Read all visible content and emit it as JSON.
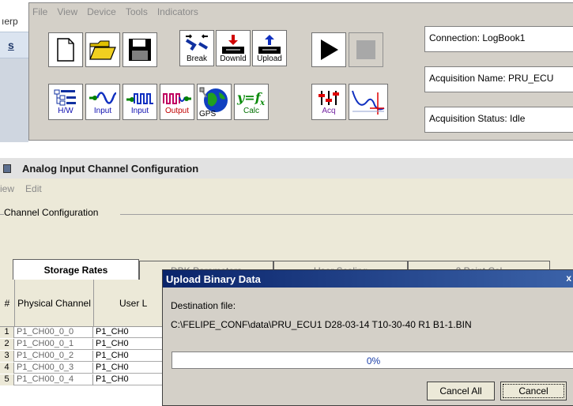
{
  "background_fragment": {
    "text1": "ıerp",
    "text2": "s"
  },
  "menubar": [
    "File",
    "View",
    "Device",
    "Tools",
    "Indicators"
  ],
  "toolbar": {
    "break": "Break",
    "download": "Downld",
    "upload": "Upload",
    "hw": "H/W",
    "input1": "Input",
    "input2": "Input",
    "output": "Output",
    "gps": "GPS",
    "calc": "Calc",
    "acq": "Acq",
    "hw_icon_text": "8SIPER\n8SACI\n8GUGE"
  },
  "info": {
    "connection": "Connection:    LogBook1",
    "acq_name": "Acquisition Name:  PRU_ECU",
    "acq_status": "Acquisition Status: Idle"
  },
  "channel_window": {
    "title": "Analog Input Channel Configuration",
    "menu": [
      "iew",
      "Edit"
    ],
    "group_label": "Channel Configuration",
    "tabs": [
      {
        "label": "Storage Rates",
        "active": true
      },
      {
        "label": "DBK Parameters",
        "active": false
      },
      {
        "label": "User Scaling",
        "active": false
      },
      {
        "label": "2 Point Cal",
        "active": false
      }
    ],
    "columns": [
      "#",
      "Physical Channel",
      "User L"
    ],
    "rows": [
      {
        "n": "1",
        "physical": "P1_CH00_0_0",
        "user": "P1_CH0"
      },
      {
        "n": "2",
        "physical": "P1_CH00_0_1",
        "user": "P1_CH0"
      },
      {
        "n": "3",
        "physical": "P1_CH00_0_2",
        "user": "P1_CH0"
      },
      {
        "n": "4",
        "physical": "P1_CH00_0_3",
        "user": "P1_CH0"
      },
      {
        "n": "5",
        "physical": "P1_CH00_0_4",
        "user": "P1_CH0"
      }
    ]
  },
  "dialog": {
    "title": "Upload Binary Data",
    "close": "x",
    "dest_label": "Destination file:",
    "dest_path": "C:\\FELIPE_CONF\\data\\PRU_ECU1 D28-03-14 T10-30-40 R1 B1-1.BIN",
    "progress_text": "0%",
    "progress_value": 0.0,
    "cancel_all": "Cancel All",
    "cancel": "Cancel"
  },
  "colors": {
    "dialog_title": "#0a246a",
    "progress": "#1a3ea8",
    "chrome": "#d4d0c8"
  }
}
